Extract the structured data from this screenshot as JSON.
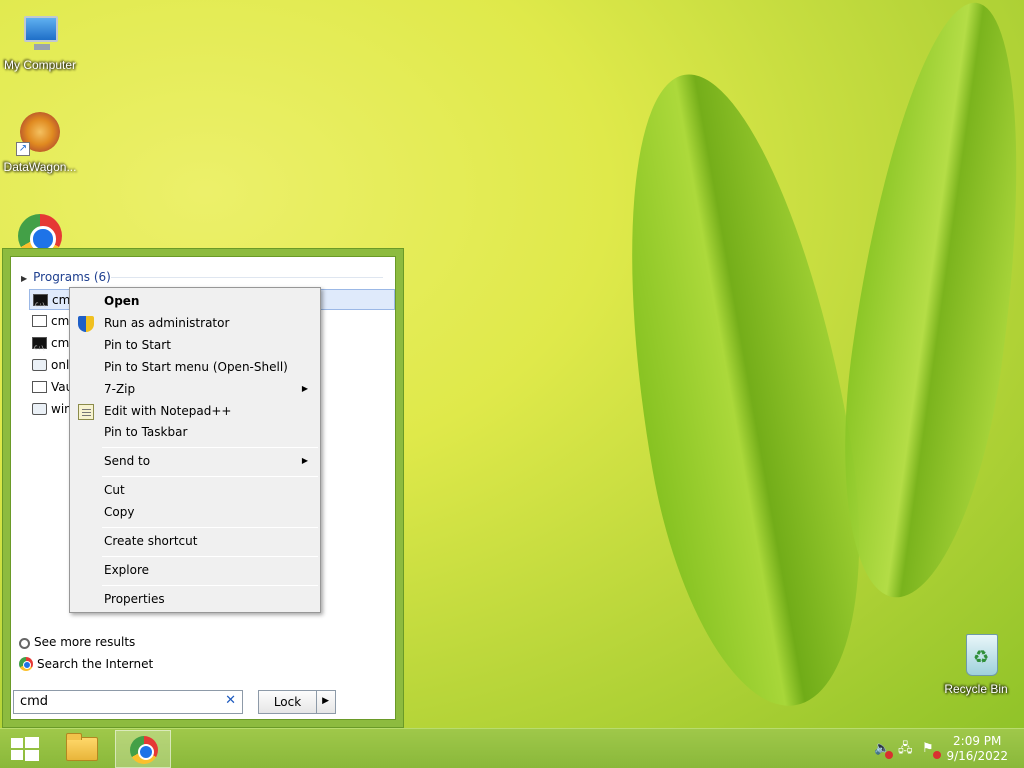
{
  "desktop": {
    "icons": [
      {
        "label": "My Computer",
        "icon": "my-computer-icon"
      },
      {
        "label": "DataWagon...",
        "icon": "datawagon-icon"
      },
      {
        "label": "",
        "icon": "chrome-icon"
      },
      {
        "label": "Recycle Bin",
        "icon": "recycle-bin-icon"
      }
    ]
  },
  "start_menu": {
    "programs_header": "Programs (6)",
    "programs": [
      {
        "label": "cmd",
        "icon": "cmd-icon"
      },
      {
        "label": "cmd",
        "icon": "window-icon"
      },
      {
        "label": "cmd",
        "icon": "cmd-shortcut-icon"
      },
      {
        "label": "onli",
        "icon": "settings-icon"
      },
      {
        "label": "Vau",
        "icon": "window-icon"
      },
      {
        "label": "win",
        "icon": "settings-icon"
      }
    ],
    "see_more": "See more results",
    "search_internet": "Search the Internet",
    "search_value": "cmd",
    "clear_glyph": "✕",
    "lock_label": "Lock",
    "lock_arrow": "▶"
  },
  "context_menu": {
    "items": [
      {
        "label": "Open",
        "bold": true
      },
      {
        "label": "Run as administrator",
        "icon": "uac-shield-icon"
      },
      {
        "label": "Pin to Start"
      },
      {
        "label": "Pin to Start menu (Open-Shell)"
      },
      {
        "label": "7-Zip",
        "submenu": true
      },
      {
        "label": "Edit with Notepad++",
        "icon": "notepad-plus-plus-icon"
      },
      {
        "label": "Pin to Taskbar"
      },
      {
        "label": "Send to",
        "submenu": true
      },
      {
        "label": "Cut"
      },
      {
        "label": "Copy"
      },
      {
        "label": "Create shortcut"
      },
      {
        "label": "Explore"
      },
      {
        "label": "Properties"
      }
    ],
    "submenu_glyph": "▶"
  },
  "taskbar": {
    "time": "2:09 PM",
    "date": "9/16/2022"
  }
}
